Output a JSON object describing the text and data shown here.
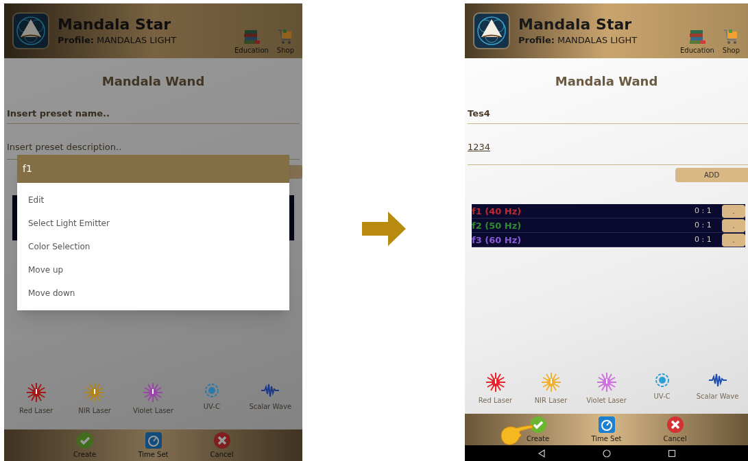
{
  "left_screen": {
    "header": {
      "app_name": "Mandala Star",
      "profile_label": "Profile:",
      "profile_name": "MANDALAS LIGHT",
      "links": [
        {
          "kind": "education",
          "label": "Education"
        },
        {
          "kind": "shop",
          "label": "Shop"
        }
      ]
    },
    "page_title": "Mandala Wand",
    "name_field": {
      "placeholder": "Insert preset name.."
    },
    "description_field": {
      "placeholder": "Insert preset description.."
    },
    "dialog": {
      "title": "f1",
      "items": [
        "Edit",
        "Select Light Emitter",
        "Color Selection",
        "Move up",
        "Move down"
      ]
    },
    "emitters": [
      {
        "kind": "laser",
        "color": "#a51818",
        "label": "Red Laser"
      },
      {
        "kind": "laser",
        "color": "#b08418",
        "label": "NIR Laser"
      },
      {
        "kind": "laser",
        "color": "#9a45a8",
        "label": "Violet Laser"
      },
      {
        "kind": "uvc",
        "color": "#2a7aa8",
        "label": "UV-C"
      },
      {
        "kind": "wave",
        "color": "#1a3a88",
        "label": "Scalar Wave"
      }
    ],
    "actions": [
      {
        "kind": "create",
        "label": "Create"
      },
      {
        "kind": "timer",
        "label": "Time Set"
      },
      {
        "kind": "cancel",
        "label": "Cancel"
      }
    ]
  },
  "right_screen": {
    "header": {
      "app_name": "Mandala Star",
      "profile_label": "Profile:",
      "profile_name": "MANDALAS LIGHT",
      "links": [
        {
          "kind": "education",
          "label": "Education"
        },
        {
          "kind": "shop",
          "label": "Shop"
        }
      ]
    },
    "page_title": "Mandala Wand",
    "name_field": {
      "value": "Tes4"
    },
    "description_field": {
      "value": "1234"
    },
    "add_button": "ADD",
    "frequencies": [
      {
        "label": "f1 (40 Hz)",
        "color": "#c0282f",
        "ratio": "0 : 1",
        "button": "."
      },
      {
        "label": "f2 (50 Hz)",
        "color": "#2e8b2e",
        "ratio": "0 : 1",
        "button": "."
      },
      {
        "label": "f3 (60 Hz)",
        "color": "#8a5ad8",
        "ratio": "0 : 1",
        "button": "."
      }
    ],
    "emitters": [
      {
        "kind": "laser",
        "color": "#e8222a",
        "label": "Red Laser"
      },
      {
        "kind": "laser",
        "color": "#f0b030",
        "label": "NIR Laser"
      },
      {
        "kind": "laser",
        "color": "#d070e0",
        "label": "Violet Laser"
      },
      {
        "kind": "uvc",
        "color": "#2f9fd8",
        "label": "UV-C"
      },
      {
        "kind": "wave",
        "color": "#1f4fb0",
        "label": "Scalar Wave"
      }
    ],
    "actions": [
      {
        "kind": "create",
        "label": "Create",
        "pointed": true
      },
      {
        "kind": "timer",
        "label": "Time Set",
        "pointed": false
      },
      {
        "kind": "cancel",
        "label": "Cancel",
        "pointed": false
      }
    ]
  }
}
